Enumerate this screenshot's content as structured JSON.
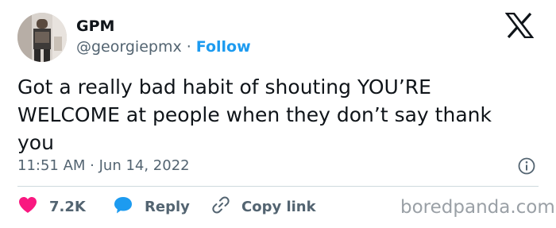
{
  "author": {
    "name": "GPM",
    "handle": "@georgiepmx",
    "separator": "·",
    "follow_label": "Follow"
  },
  "tweet": {
    "text": "Got a really bad habit of shouting YOU’RE WELCOME at people when they don’t say thank you",
    "timestamp": "11:51 AM · Jun 14, 2022"
  },
  "actions": {
    "likes": "7.2K",
    "reply_label": "Reply",
    "copy_label": "Copy link"
  },
  "watermark": "boredpanda.com",
  "icons": {
    "brand": "x-logo-icon",
    "like": "heart-icon",
    "reply": "speech-bubble-icon",
    "copy": "link-icon",
    "info": "info-icon"
  },
  "colors": {
    "text": "#0f1419",
    "muted": "#536471",
    "accent": "#1d9bf0",
    "like": "#f91880",
    "divider": "#cfd9de",
    "watermark": "#9aa0a6"
  }
}
